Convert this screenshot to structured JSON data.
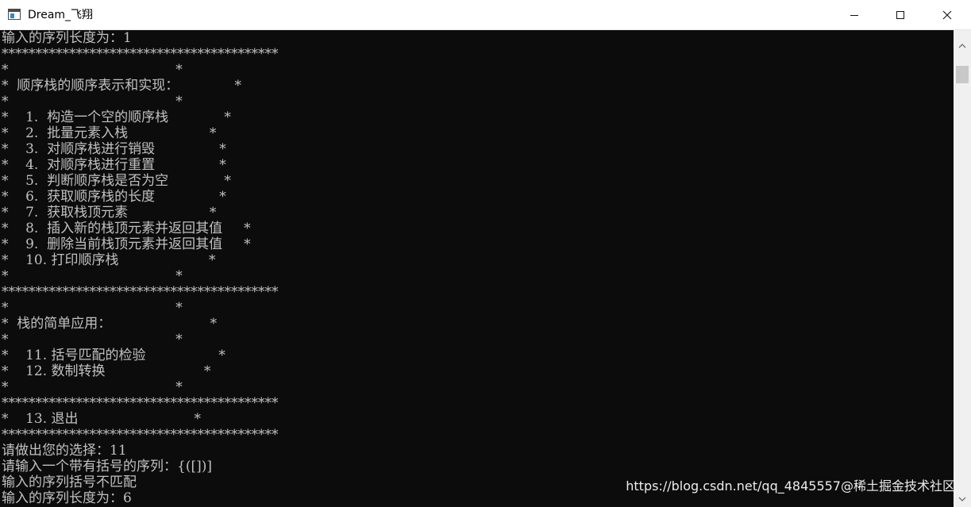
{
  "window": {
    "title": "Dream_飞翔",
    "icon": "console-window-icon",
    "buttons": [
      "minimize-icon",
      "maximize-icon",
      "close-icon"
    ]
  },
  "console": {
    "lines": [
      "输入的序列长度为：1",
      "*****************************************",
      "*                                       *",
      "*  顺序栈的顺序表示和实现：             *",
      "*                                       *",
      "*    1.  构造一个空的顺序栈             *",
      "*    2.  批量元素入栈                   *",
      "*    3.  对顺序栈进行销毁               *",
      "*    4.  对顺序栈进行重置               *",
      "*    5.  判断顺序栈是否为空             *",
      "*    6.  获取顺序栈的长度               *",
      "*    7.  获取栈顶元素                   *",
      "*    8.  插入新的栈顶元素并返回其值     *",
      "*    9.  删除当前栈顶元素并返回其值     *",
      "*    10. 打印顺序栈                     *",
      "*                                       *",
      "*****************************************",
      "*                                       *",
      "*  栈的简单应用：                       *",
      "*                                       *",
      "*    11. 括号匹配的检验                 *",
      "*    12. 数制转换                       *",
      "*                                       *",
      "*****************************************",
      "*    13. 退出                           *",
      "*****************************************",
      "请做出您的选择：11",
      "请输入一个带有括号的序列：{([])]",
      "输入的序列括号不匹配",
      "输入的序列长度为：6"
    ]
  },
  "watermark": "https://blog.csdn.net/qq_4845557@稀土掘金技术社区"
}
